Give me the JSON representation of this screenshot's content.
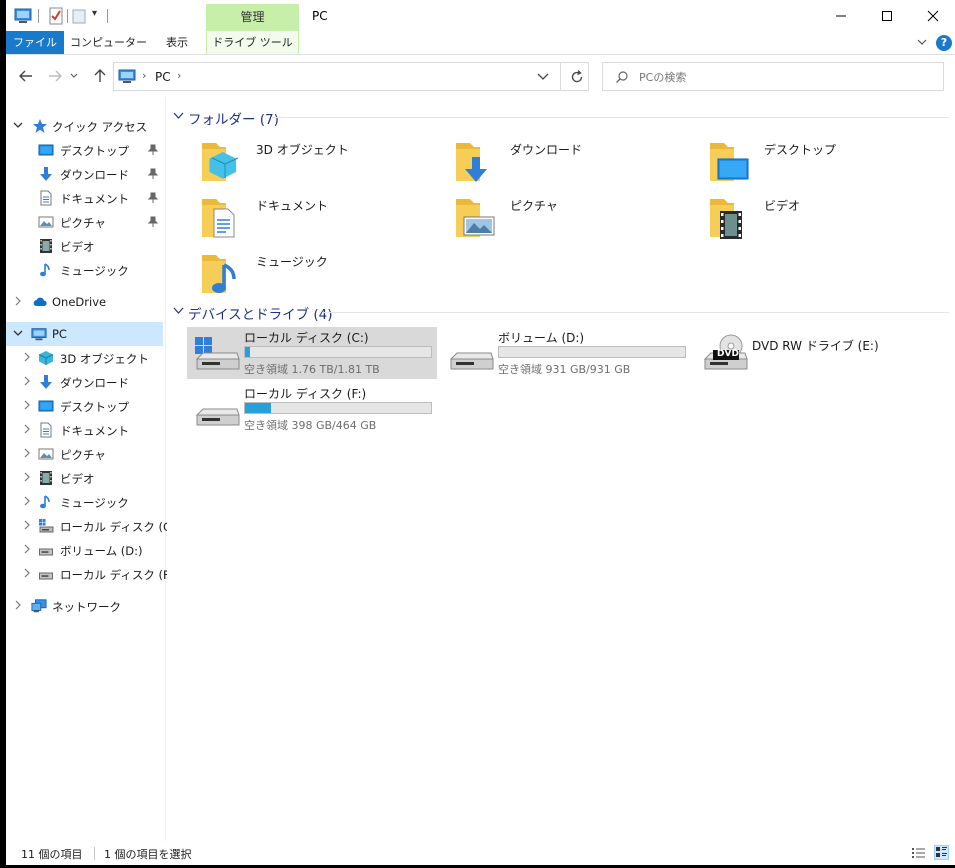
{
  "window": {
    "title": "PC",
    "context_tab": "管理",
    "help_label": "?"
  },
  "ribbon": {
    "tabs": [
      {
        "label": "ファイル"
      },
      {
        "label": "コンピューター"
      },
      {
        "label": "表示"
      },
      {
        "label": "ドライブ ツール"
      }
    ]
  },
  "address": {
    "segments": [
      "PC"
    ],
    "separator": "›"
  },
  "search": {
    "placeholder": "PCの検索"
  },
  "sidebar": {
    "quick_access": {
      "label": "クイック アクセス",
      "items": [
        {
          "label": "デスクトップ",
          "icon": "desktop-icon",
          "pinned": true
        },
        {
          "label": "ダウンロード",
          "icon": "download-icon",
          "pinned": true
        },
        {
          "label": "ドキュメント",
          "icon": "document-icon",
          "pinned": true
        },
        {
          "label": "ピクチャ",
          "icon": "picture-icon",
          "pinned": true
        },
        {
          "label": "ビデオ",
          "icon": "video-icon",
          "pinned": false
        },
        {
          "label": "ミュージック",
          "icon": "music-icon",
          "pinned": false
        }
      ]
    },
    "onedrive": {
      "label": "OneDrive"
    },
    "pc": {
      "label": "PC",
      "items": [
        {
          "label": "3D オブジェクト",
          "icon": "3d-objects-icon"
        },
        {
          "label": "ダウンロード",
          "icon": "download-icon"
        },
        {
          "label": "デスクトップ",
          "icon": "desktop-icon"
        },
        {
          "label": "ドキュメント",
          "icon": "document-icon"
        },
        {
          "label": "ピクチャ",
          "icon": "picture-icon"
        },
        {
          "label": "ビデオ",
          "icon": "video-icon"
        },
        {
          "label": "ミュージック",
          "icon": "music-icon"
        },
        {
          "label": "ローカル ディスク (C:)",
          "icon": "windows-drive-icon"
        },
        {
          "label": "ボリューム (D:)",
          "icon": "drive-icon"
        },
        {
          "label": "ローカル ディスク (F:)",
          "icon": "drive-icon"
        }
      ]
    },
    "network": {
      "label": "ネットワーク"
    }
  },
  "content": {
    "folders_group": {
      "title": "フォルダー (7)",
      "items": [
        {
          "label": "3D オブジェクト",
          "icon": "3d-objects-folder-icon"
        },
        {
          "label": "ダウンロード",
          "icon": "download-folder-icon"
        },
        {
          "label": "デスクトップ",
          "icon": "desktop-folder-icon"
        },
        {
          "label": "ドキュメント",
          "icon": "document-folder-icon"
        },
        {
          "label": "ピクチャ",
          "icon": "picture-folder-icon"
        },
        {
          "label": "ビデオ",
          "icon": "video-folder-icon"
        },
        {
          "label": "ミュージック",
          "icon": "music-folder-icon"
        }
      ]
    },
    "drives_group": {
      "title": "デバイスとドライブ (4)",
      "items": [
        {
          "name": "ローカル ディスク (C:)",
          "free_text": "空き領域 1.76 TB/1.81 TB",
          "used_fraction": 0.028,
          "icon": "windows-drive-icon",
          "selected": true
        },
        {
          "name": "ボリューム (D:)",
          "free_text": "空き領域 931 GB/931 GB",
          "used_fraction": 0.0,
          "icon": "drive-icon",
          "selected": false
        },
        {
          "name": "DVD RW ドライブ (E:)",
          "free_text": "",
          "used_fraction": null,
          "icon": "dvd-drive-icon",
          "badge": "DVD",
          "selected": false
        },
        {
          "name": "ローカル ディスク (F:)",
          "free_text": "空き領域 398 GB/464 GB",
          "used_fraction": 0.142,
          "icon": "drive-icon",
          "selected": false
        }
      ]
    }
  },
  "status": {
    "item_count": "11 個の項目",
    "selected": "1 個の項目を選択"
  },
  "colors": {
    "accent": "#1979ca",
    "context_tab": "#c7efa9",
    "selection": "#cce8ff",
    "drive_bar": "#26a0da",
    "group_title": "#1e3287",
    "folder_yellow": "#f6cd57"
  }
}
